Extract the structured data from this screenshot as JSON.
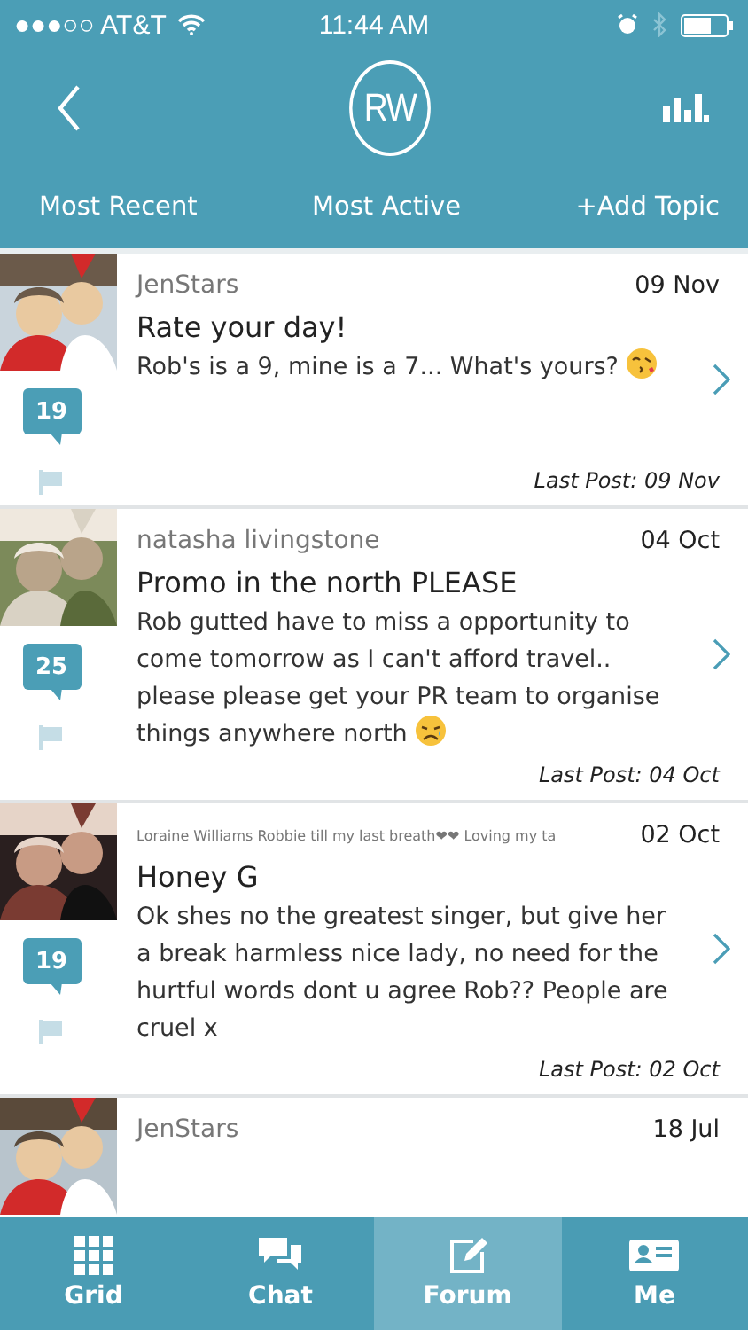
{
  "status_bar": {
    "carrier": "●●●○○ AT&T",
    "time": "11:44 AM"
  },
  "header": {
    "logo": "RW"
  },
  "tabs": [
    {
      "label": "Most Recent"
    },
    {
      "label": "Most Active"
    },
    {
      "label": "+Add Topic"
    }
  ],
  "posts": [
    {
      "kind": "kiss_emoji",
      "author": "JenStars",
      "date": "09 Nov",
      "title": "Rate your day!",
      "body": "Rob's is a 9, mine is a 7... What's yours?",
      "count": "19",
      "last_post": "Last Post: 09 Nov"
    },
    {
      "kind": "sad_emoji",
      "author": "natasha livingstone",
      "date": "04 Oct",
      "title": "Promo in the north PLEASE",
      "body": "Rob gutted have to miss a opportunity to come tomorrow as I can't afford travel.. please please get your PR team to organise things anywhere north",
      "count": "25",
      "last_post": "Last Post: 04 Oct"
    },
    {
      "kind": "signature",
      "author": "Loraine Williams Robbie till my last breath❤❤ Loving my ta",
      "date": "02 Oct",
      "title": "Honey G",
      "body": "Ok shes no the greatest singer, but give her a break harmless nice lady, no need for the hurtful words dont u agree Rob?? People are cruel x",
      "count": "19",
      "last_post": "Last Post: 02 Oct"
    },
    {
      "kind": "plain",
      "author": "JenStars",
      "date": "18 Jul"
    }
  ],
  "nav": [
    {
      "label": "Grid",
      "kind": "grid",
      "selected": false
    },
    {
      "label": "Chat",
      "kind": "chat",
      "selected": false
    },
    {
      "label": "Forum",
      "kind": "forum",
      "selected": true
    },
    {
      "label": "Me",
      "kind": "card",
      "selected": false
    }
  ]
}
